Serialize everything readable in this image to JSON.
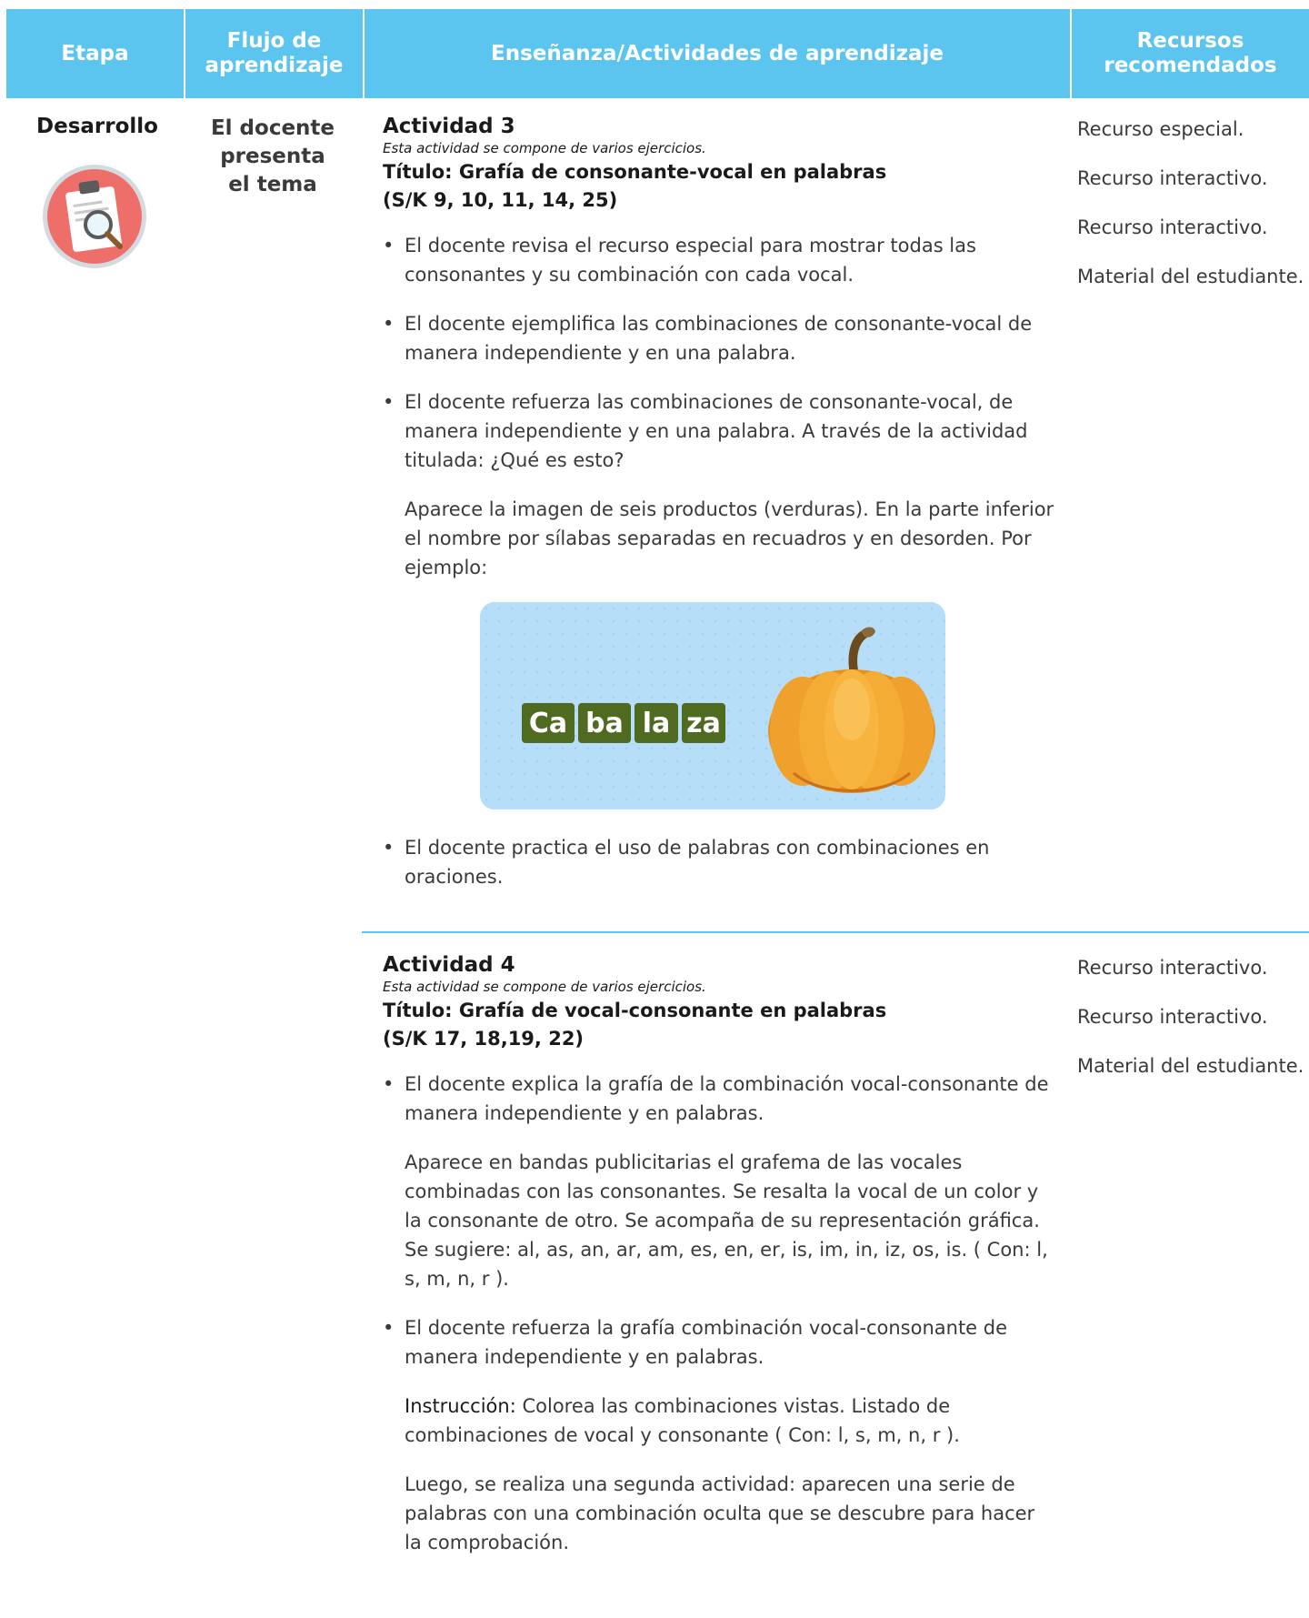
{
  "header": {
    "col1": "Etapa",
    "col2": "Flujo de\naprendizaje",
    "col3": "Enseñanza/Actividades de aprendizaje",
    "col4": "Recursos\nrecomendados",
    "background_color": "#5bc4ef"
  },
  "stage": {
    "label": "Desarrollo",
    "icon": "clipboard-magnifier-icon"
  },
  "flow": {
    "label": "El docente\npresenta\nel tema"
  },
  "activity3": {
    "title": "Actividad 3",
    "note": "Esta actividad se compone de varios ejercicios.",
    "subtitle": "Título: Grafía de consonante-vocal en palabras",
    "standards": "(S/K 9, 10, 11, 14, 25)",
    "bullet1": "El docente revisa el recurso especial para mostrar todas las consonantes y su combinación con cada vocal.",
    "bullet2": "El docente ejemplifica las combinaciones de consonante-vocal de manera independiente y en una palabra.",
    "bullet3": "El docente refuerza las combinaciones de consonante-vocal, de manera independiente y en una palabra. A través de la actividad titulada: ¿Qué es esto?",
    "para1": "Aparece la imagen de seis productos (verduras). En la parte inferior el nombre por sílabas separadas en recuadros y en desorden. Por ejemplo:",
    "example": {
      "syllables": [
        "Ca",
        "ba",
        "la",
        "za"
      ],
      "image": "pumpkin-illustration",
      "tile_color": "#4f6b1f",
      "card_color": "#b7def8"
    },
    "bullet4": "El docente practica el uso de palabras con combinaciones en oraciones."
  },
  "resources3": [
    "Recurso especial.",
    "Recurso interactivo.",
    "Recurso interactivo.",
    "Material del estudiante."
  ],
  "activity4": {
    "title": "Actividad 4",
    "note": "Esta actividad se compone de varios ejercicios.",
    "subtitle": "Título: Grafía de vocal-consonante en palabras",
    "standards": "(S/K 17, 18,19, 22)",
    "bullet1": "El docente explica la grafía de la combinación vocal-consonante de manera independiente y en palabras.",
    "para1": "Aparece en bandas publicitarias el grafema de las vocales combinadas con las consonantes. Se resalta la vocal de un color y la consonante de otro. Se acompaña de su representación gráfica. Se sugiere: al, as, an, ar, am, es, en, er, is, im, in, iz, os, is. ( Con: l, s, m, n, r ).",
    "bullet2": "El docente refuerza la grafía combinación vocal-consonante de manera independiente y en palabras.",
    "instr_label": "Instrucción:",
    "instr_text": "Colorea las combinaciones vistas. Listado de combinaciones de vocal y consonante ( Con: l, s, m, n, r ).",
    "para2": "Luego, se realiza una segunda actividad: aparecen una serie de palabras con una combinación oculta que se descubre para hacer la comprobación."
  },
  "resources4": [
    "Recurso interactivo.",
    "Recurso interactivo.",
    "Material del estudiante."
  ]
}
